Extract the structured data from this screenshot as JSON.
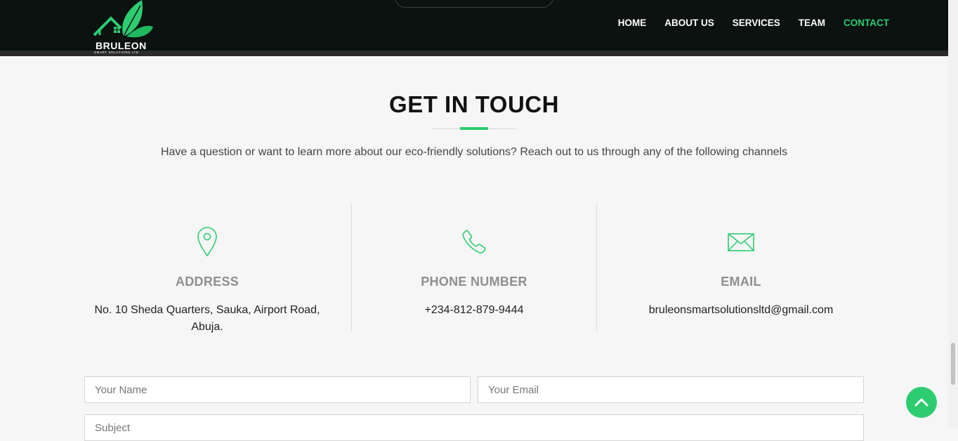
{
  "brand": {
    "name": "BRULEON",
    "tagline": "SMART SOLUTIONS LTD",
    "accent_color": "#2ecc71"
  },
  "nav": {
    "items": [
      {
        "label": "HOME"
      },
      {
        "label": "ABOUT US"
      },
      {
        "label": "SERVICES"
      },
      {
        "label": "TEAM"
      },
      {
        "label": "CONTACT",
        "active": true
      }
    ]
  },
  "section": {
    "title": "GET IN TOUCH",
    "subtitle": "Have a question or want to learn more about our eco-friendly solutions? Reach out to us through any of the following channels"
  },
  "contact": {
    "address": {
      "icon": "map-pin-icon",
      "label": "ADDRESS",
      "value": "No. 10 Sheda Quarters, Sauka, Airport Road, Abuja."
    },
    "phone": {
      "icon": "phone-icon",
      "label": "PHONE NUMBER",
      "value": "+234-812-879-9444"
    },
    "email": {
      "icon": "envelope-icon",
      "label": "EMAIL",
      "value": "bruleonsmartsolutionsltd@gmail.com"
    }
  },
  "form": {
    "name_placeholder": "Your Name",
    "email_placeholder": "Your Email",
    "subject_placeholder": "Subject"
  },
  "back_to_top": {
    "icon": "chevron-up-icon"
  }
}
